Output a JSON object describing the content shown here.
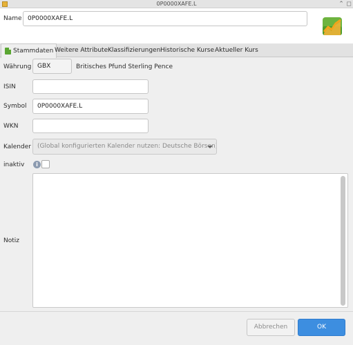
{
  "window": {
    "title": "0P0000XAFE.L",
    "controls": [
      "⌃",
      "◻"
    ]
  },
  "header": {
    "name_label": "Name",
    "name_value": "0P0000XAFE.L"
  },
  "tabs": [
    {
      "label": "Stammdaten"
    },
    {
      "label": "Weitere Attribute"
    },
    {
      "label": "Klassifizierungen"
    },
    {
      "label": "Historische Kurse"
    },
    {
      "label": "Aktueller Kurs"
    }
  ],
  "form": {
    "currency_label": "Währung",
    "currency_code": "GBX",
    "currency_name": "Britisches Pfund Sterling Pence",
    "isin_label": "ISIN",
    "isin_value": "",
    "symbol_label": "Symbol",
    "symbol_value": "0P0000XAFE.L",
    "wkn_label": "WKN",
    "wkn_value": "",
    "calendar_label": "Kalender",
    "calendar_value": "(Global konfigurierten Kalender nutzen: Deutsche Börsen)",
    "inactive_label": "inaktiv",
    "inactive_checked": false,
    "notes_label": "Notiz",
    "notes_value": ""
  },
  "buttons": {
    "cancel": "Abbrechen",
    "ok": "OK"
  },
  "colors": {
    "accent": "#3d8ee0",
    "tab_icon": "#5aa632"
  },
  "icons": {
    "app": "app-icon",
    "logo": "portfolio-chart-logo",
    "tab": "page-icon",
    "info": "info-icon",
    "dropdown": "chevron-down-icon"
  }
}
